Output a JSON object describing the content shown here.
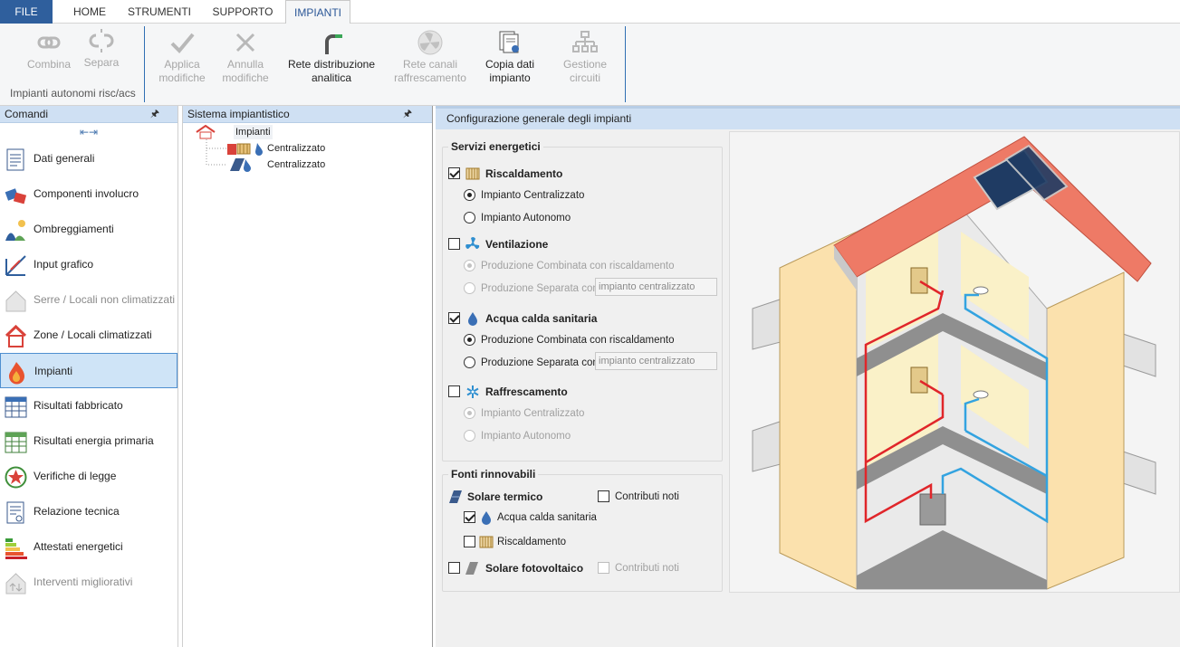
{
  "tabs": {
    "file": "FILE",
    "home": "HOME",
    "strumenti": "STRUMENTI",
    "supporto": "SUPPORTO",
    "impianti": "IMPIANTI"
  },
  "ribbon": {
    "combina": "Combina",
    "separa": "Separa",
    "group1_label": "Impianti autonomi risc/acs",
    "applica_1": "Applica",
    "applica_2": "modifiche",
    "annulla_1": "Annulla",
    "annulla_2": "modifiche",
    "rete_1": "Rete distribuzione",
    "rete_2": "analitica",
    "canali_1": "Rete canali",
    "canali_2": "raffrescamento",
    "copia_1": "Copia dati",
    "copia_2": "impianto",
    "gestione_1": "Gestione",
    "gestione_2": "circuiti"
  },
  "left_panel": {
    "title": "Comandi",
    "items": [
      {
        "label": "Dati generali",
        "icon": "document-icon"
      },
      {
        "label": "Componenti involucro",
        "icon": "blocks-icon"
      },
      {
        "label": "Ombreggiamenti",
        "icon": "shading-icon"
      },
      {
        "label": "Input grafico",
        "icon": "drawing-icon"
      },
      {
        "label": "Serre / Locali non climatizzati",
        "icon": "house-icon"
      },
      {
        "label": "Zone / Locali climatizzati",
        "icon": "house-icon"
      },
      {
        "label": "Impianti",
        "icon": "flame-icon"
      },
      {
        "label": "Risultati fabbricato",
        "icon": "calculator-icon"
      },
      {
        "label": "Risultati energia primaria",
        "icon": "calculator-icon"
      },
      {
        "label": "Verifiche di legge",
        "icon": "seal-icon"
      },
      {
        "label": "Relazione tecnica",
        "icon": "report-icon"
      },
      {
        "label": "Attestati energetici",
        "icon": "energy-class-icon"
      },
      {
        "label": "Interventi migliorativi",
        "icon": "house-arrows-icon"
      }
    ]
  },
  "mid_panel": {
    "title": "Sistema impiantistico",
    "root": "Impianti",
    "child1": "Centralizzato",
    "child2": "Centralizzato"
  },
  "right_panel": {
    "title": "Configurazione generale degli impianti",
    "servizi": {
      "legend": "Servizi energetici",
      "riscaldamento": "Riscaldamento",
      "risc_centr": "Impianto Centralizzato",
      "risc_auton": "Impianto Autonomo",
      "ventilazione": "Ventilazione",
      "vent_comb": "Produzione Combinata con riscaldamento",
      "vent_sep": "Produzione Separata con",
      "vent_sep_val": "impianto centralizzato",
      "acs": "Acqua calda sanitaria",
      "acs_comb": "Produzione Combinata con riscaldamento",
      "acs_sep": "Produzione Separata con",
      "acs_sep_val": "impianto centralizzato",
      "raffrescamento": "Raffrescamento",
      "raff_centr": "Impianto Centralizzato",
      "raff_auton": "Impianto Autonomo"
    },
    "fonti": {
      "legend": "Fonti rinnovabili",
      "solare_termico": "Solare termico",
      "contributi_noti_1": "Contributi noti",
      "acs": "Acqua calda sanitaria",
      "risc": "Riscaldamento",
      "fotovoltaico": "Solare fotovoltaico",
      "contributi_noti_2": "Contributi noti"
    }
  },
  "colors": {
    "accent": "#2f5f9d",
    "panel_header": "#cfe0f3",
    "supply_pipe": "#e0262a",
    "return_pipe": "#33a3e0",
    "roof": "#ee7a66",
    "wall": "#fbe7b5"
  }
}
